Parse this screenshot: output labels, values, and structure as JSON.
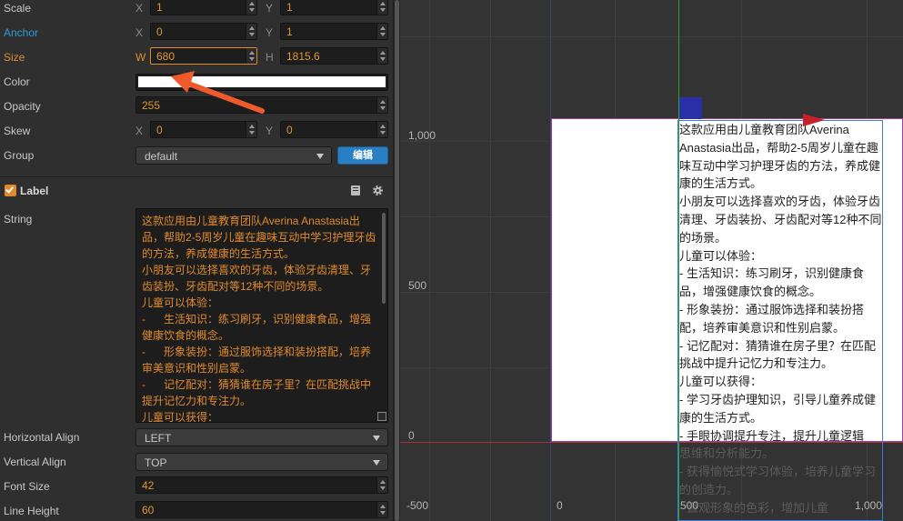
{
  "inspector": {
    "scale": {
      "label": "Scale",
      "x_axis": "X",
      "x": "1",
      "y_axis": "Y",
      "y": "1"
    },
    "anchor": {
      "label": "Anchor",
      "x_axis": "X",
      "x": "0",
      "y_axis": "Y",
      "y": "1"
    },
    "size": {
      "label": "Size",
      "w_axis": "W",
      "w": "680",
      "h_axis": "H",
      "h": "1815.6"
    },
    "color": {
      "label": "Color",
      "value": "#ffffff"
    },
    "opacity": {
      "label": "Opacity",
      "value": "255"
    },
    "skew": {
      "label": "Skew",
      "x_axis": "X",
      "x": "0",
      "y_axis": "Y",
      "y": "0"
    },
    "group": {
      "label": "Group",
      "value": "default",
      "edit_button": "编辑"
    },
    "label_component": {
      "title": "Label",
      "string_label": "String",
      "string_value": "这款应用由儿童教育团队Averina Anastasia出品，帮助2-5周岁儿童在趣味互动中学习护理牙齿的方法，养成健康的生活方式。\n小朋友可以选择喜欢的牙齿，体验牙齿清理、牙齿装扮、牙齿配对等12种不同的场景。\n儿童可以体验：\n-      生活知识：练习刷牙，识别健康食品，增强健康饮食的概念。\n-      形象装扮：通过服饰选择和装扮搭配，培养审美意识和性别启蒙。\n-      记忆配对：猜猜谁在房子里？在匹配挑战中提升记忆力和专注力。\n儿童可以获得：",
      "horizontal_align": {
        "label": "Horizontal Align",
        "value": "LEFT"
      },
      "vertical_align": {
        "label": "Vertical Align",
        "value": "TOP"
      },
      "font_size": {
        "label": "Font Size",
        "value": "42"
      },
      "line_height": {
        "label": "Line Height",
        "value": "60"
      }
    }
  },
  "scene": {
    "y_labels": [
      "1,000",
      "500",
      "0"
    ],
    "x_labels": [
      "-500",
      "0",
      "500",
      "1,000"
    ],
    "label_text": "这款应用由儿童教育团队Averina Anastasia出品，帮助2-5周岁儿童在趣味互动中学习护理牙齿的方法，养成健康的生活方式。\n小朋友可以选择喜欢的牙齿，体验牙齿清理、牙齿装扮、牙齿配对等12种不同的场景。\n儿童可以体验：\n- 生活知识：练习刷牙，识别健康食品，增强健康饮食的概念。\n- 形象装扮：通过服饰选择和装扮搭配，培养审美意识和性别启蒙。\n- 记忆配对：猜猜谁在房子里？在匹配挑战中提升记忆力和专注力。\n儿童可以获得：\n- 学习牙齿护理知识，引导儿童养成健康的生活方式。\n- 手眼协调提升专注，提升儿童逻辑",
    "label_text_faded": "思维和分析能力。\n- 获得愉悦式学习体验，培养儿童学习的创造力。\n- 直观形象的色彩，增加儿童"
  },
  "colors": {
    "accent_orange": "#e08a2d",
    "accent_blue": "#2f9bd8",
    "edit_button": "#2a7fc4",
    "axis_green": "#2ca52c",
    "axis_red": "#a8323c"
  }
}
